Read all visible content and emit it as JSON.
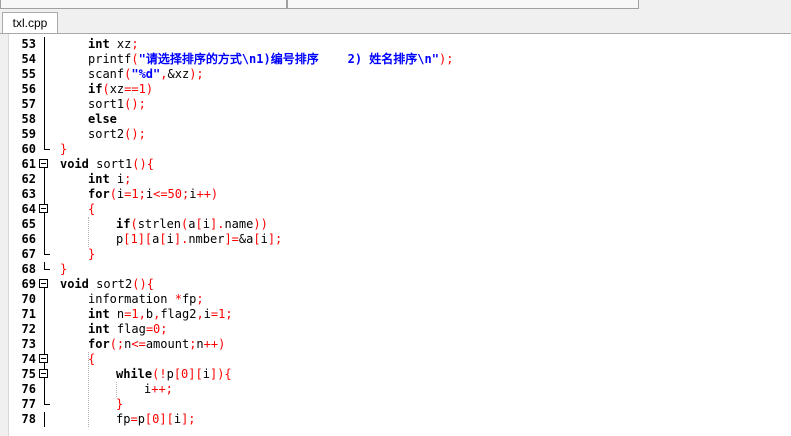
{
  "tab": {
    "filename": "txl.cpp"
  },
  "lines": [
    {
      "num": "53",
      "fold": "line",
      "indent": 1,
      "tokens": [
        [
          "kw",
          "int"
        ],
        [
          "t",
          " xz"
        ],
        [
          "op",
          ";"
        ]
      ]
    },
    {
      "num": "54",
      "fold": "line",
      "indent": 1,
      "tokens": [
        [
          "t",
          "printf"
        ],
        [
          "op",
          "("
        ],
        [
          "str",
          "\"请选择排序的方式\\n1)编号排序    2) 姓名排序\\n\""
        ],
        [
          "op",
          ");"
        ]
      ]
    },
    {
      "num": "55",
      "fold": "line",
      "indent": 1,
      "tokens": [
        [
          "t",
          "scanf"
        ],
        [
          "op",
          "("
        ],
        [
          "str",
          "\"%d\""
        ],
        [
          "op",
          ","
        ],
        [
          "t",
          "&xz"
        ],
        [
          "op",
          ");"
        ]
      ]
    },
    {
      "num": "56",
      "fold": "line",
      "indent": 1,
      "tokens": [
        [
          "kw",
          "if"
        ],
        [
          "op",
          "("
        ],
        [
          "t",
          "xz"
        ],
        [
          "op",
          "=="
        ],
        [
          "num",
          "1"
        ],
        [
          "op",
          ")"
        ]
      ]
    },
    {
      "num": "57",
      "fold": "line",
      "indent": 1,
      "tokens": [
        [
          "t",
          "sort1"
        ],
        [
          "op",
          "();"
        ]
      ]
    },
    {
      "num": "58",
      "fold": "line",
      "indent": 1,
      "tokens": [
        [
          "kw",
          "else"
        ]
      ]
    },
    {
      "num": "59",
      "fold": "line",
      "indent": 1,
      "tokens": [
        [
          "t",
          "sort2"
        ],
        [
          "op",
          "();"
        ]
      ]
    },
    {
      "num": "60",
      "fold": "end",
      "indent": 0,
      "tokens": [
        [
          "br",
          "}"
        ]
      ]
    },
    {
      "num": "61",
      "fold": "box",
      "indent": 0,
      "tokens": [
        [
          "kw",
          "void"
        ],
        [
          "t",
          " sort1"
        ],
        [
          "op",
          "(){"
        ]
      ]
    },
    {
      "num": "62",
      "fold": "line",
      "indent": 1,
      "tokens": [
        [
          "kw",
          "int"
        ],
        [
          "t",
          " i"
        ],
        [
          "op",
          ";"
        ]
      ]
    },
    {
      "num": "63",
      "fold": "line",
      "indent": 1,
      "tokens": [
        [
          "kw",
          "for"
        ],
        [
          "op",
          "("
        ],
        [
          "t",
          "i"
        ],
        [
          "op",
          "="
        ],
        [
          "num",
          "1"
        ],
        [
          "op",
          ";"
        ],
        [
          "t",
          "i"
        ],
        [
          "op",
          "<="
        ],
        [
          "num",
          "50"
        ],
        [
          "op",
          ";"
        ],
        [
          "t",
          "i"
        ],
        [
          "op",
          "++)"
        ]
      ]
    },
    {
      "num": "64",
      "fold": "box",
      "indent": 1,
      "tokens": [
        [
          "br",
          "{"
        ]
      ]
    },
    {
      "num": "65",
      "fold": "line",
      "indent": 2,
      "tokens": [
        [
          "kw",
          "if"
        ],
        [
          "op",
          "("
        ],
        [
          "t",
          "strlen"
        ],
        [
          "op",
          "("
        ],
        [
          "t",
          "a"
        ],
        [
          "op",
          "["
        ],
        [
          "t",
          "i"
        ],
        [
          "op",
          "]."
        ],
        [
          "t",
          "name"
        ],
        [
          "op",
          "))"
        ]
      ]
    },
    {
      "num": "66",
      "fold": "line",
      "indent": 2,
      "tokens": [
        [
          "t",
          "p"
        ],
        [
          "op",
          "["
        ],
        [
          "num",
          "1"
        ],
        [
          "op",
          "]["
        ],
        [
          "t",
          "a"
        ],
        [
          "op",
          "["
        ],
        [
          "t",
          "i"
        ],
        [
          "op",
          "]."
        ],
        [
          "t",
          "nmber"
        ],
        [
          "op",
          "]="
        ],
        [
          "t",
          "&a"
        ],
        [
          "op",
          "["
        ],
        [
          "t",
          "i"
        ],
        [
          "op",
          "];"
        ]
      ]
    },
    {
      "num": "67",
      "fold": "end",
      "indent": 1,
      "tokens": [
        [
          "br",
          "}"
        ]
      ]
    },
    {
      "num": "68",
      "fold": "end",
      "indent": 0,
      "tokens": [
        [
          "br",
          "}"
        ]
      ]
    },
    {
      "num": "69",
      "fold": "box",
      "indent": 0,
      "tokens": [
        [
          "kw",
          "void"
        ],
        [
          "t",
          " sort2"
        ],
        [
          "op",
          "(){"
        ]
      ]
    },
    {
      "num": "70",
      "fold": "line",
      "indent": 1,
      "tokens": [
        [
          "t",
          "information "
        ],
        [
          "op",
          "*"
        ],
        [
          "t",
          "fp"
        ],
        [
          "op",
          ";"
        ]
      ]
    },
    {
      "num": "71",
      "fold": "line",
      "indent": 1,
      "tokens": [
        [
          "kw",
          "int"
        ],
        [
          "t",
          " n"
        ],
        [
          "op",
          "="
        ],
        [
          "num",
          "1"
        ],
        [
          "op",
          ","
        ],
        [
          "t",
          "b"
        ],
        [
          "op",
          ","
        ],
        [
          "t",
          "flag2"
        ],
        [
          "op",
          ","
        ],
        [
          "t",
          "i"
        ],
        [
          "op",
          "="
        ],
        [
          "num",
          "1"
        ],
        [
          "op",
          ";"
        ]
      ]
    },
    {
      "num": "72",
      "fold": "line",
      "indent": 1,
      "tokens": [
        [
          "kw",
          "int"
        ],
        [
          "t",
          " flag"
        ],
        [
          "op",
          "="
        ],
        [
          "num",
          "0"
        ],
        [
          "op",
          ";"
        ]
      ]
    },
    {
      "num": "73",
      "fold": "line",
      "indent": 1,
      "tokens": [
        [
          "kw",
          "for"
        ],
        [
          "op",
          "(;"
        ],
        [
          "t",
          "n"
        ],
        [
          "op",
          "<="
        ],
        [
          "t",
          "amount"
        ],
        [
          "op",
          ";"
        ],
        [
          "t",
          "n"
        ],
        [
          "op",
          "++)"
        ]
      ]
    },
    {
      "num": "74",
      "fold": "box",
      "indent": 1,
      "tokens": [
        [
          "br",
          "{"
        ]
      ]
    },
    {
      "num": "75",
      "fold": "box",
      "indent": 2,
      "tokens": [
        [
          "kw",
          "while"
        ],
        [
          "op",
          "(!"
        ],
        [
          "t",
          "p"
        ],
        [
          "op",
          "["
        ],
        [
          "num",
          "0"
        ],
        [
          "op",
          "]["
        ],
        [
          "t",
          "i"
        ],
        [
          "op",
          "]){"
        ]
      ]
    },
    {
      "num": "76",
      "fold": "line",
      "indent": 3,
      "tokens": [
        [
          "t",
          "i"
        ],
        [
          "op",
          "++;"
        ]
      ]
    },
    {
      "num": "77",
      "fold": "end",
      "indent": 2,
      "tokens": [
        [
          "br",
          "}"
        ]
      ]
    },
    {
      "num": "78",
      "fold": "line",
      "indent": 2,
      "tokens": [
        [
          "t",
          "fp"
        ],
        [
          "op",
          "="
        ],
        [
          "t",
          "p"
        ],
        [
          "op",
          "["
        ],
        [
          "num",
          "0"
        ],
        [
          "op",
          "]["
        ],
        [
          "t",
          "i"
        ],
        [
          "op",
          "];"
        ]
      ]
    }
  ]
}
